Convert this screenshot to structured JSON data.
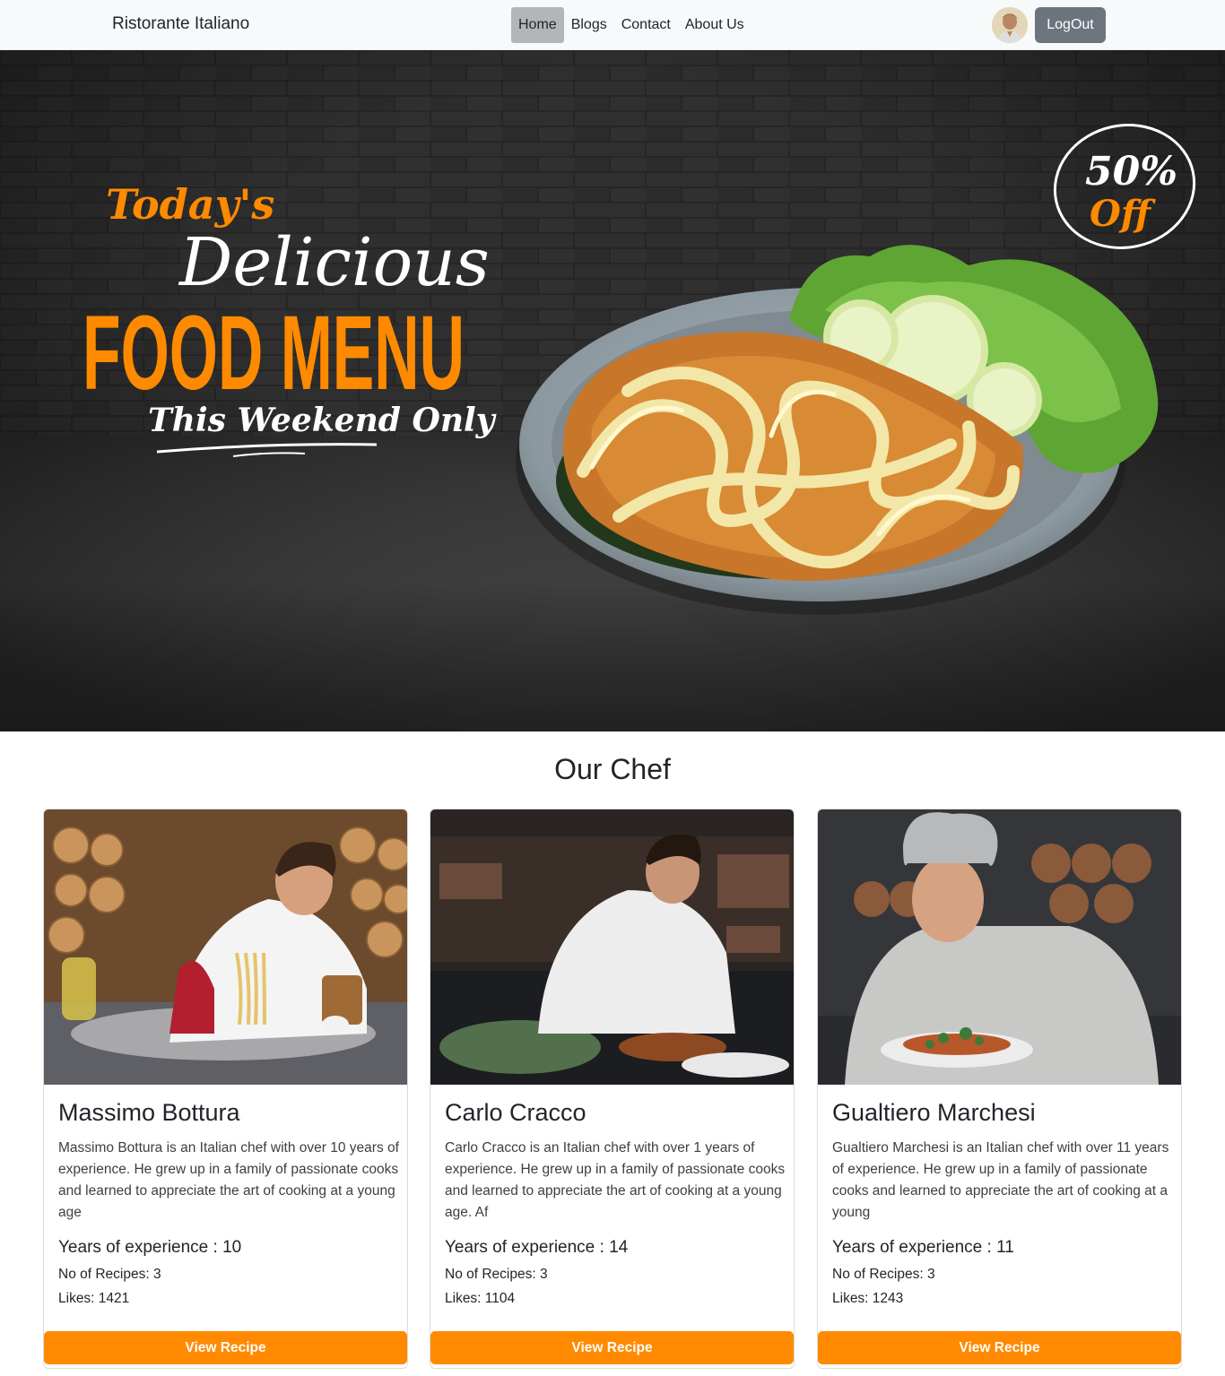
{
  "nav": {
    "brand": "Ristorante Italiano",
    "links": [
      {
        "label": "Home"
      },
      {
        "label": "Blogs"
      },
      {
        "label": "Contact"
      },
      {
        "label": "About Us"
      }
    ],
    "logout_label": "LogOut"
  },
  "hero": {
    "line1": "Today's",
    "line2": "Delicious",
    "line3": "FOOD MENU",
    "line4": "This Weekend Only",
    "badge_top": "50%",
    "badge_bottom": "Off"
  },
  "section": {
    "title": "Our Chef"
  },
  "chefs": [
    {
      "name": "Massimo Bottura",
      "bio": "Massimo Bottura is an Italian chef with over 10 years of experience. He grew up in a family of passionate cooks and learned to appreciate the art of cooking at a young age",
      "experience": "Years of experience : 10",
      "recipes": "No of Recipes: 3",
      "likes": "Likes: 1421",
      "button": "View Recipe"
    },
    {
      "name": "Carlo Cracco",
      "bio": "Carlo Cracco is an Italian chef with over 1 years of experience. He grew up in a family of passionate cooks and learned to appreciate the art of cooking at a young age. Af",
      "experience": "Years of experience : 14",
      "recipes": "No of Recipes: 3",
      "likes": "Likes: 1104",
      "button": "View Recipe"
    },
    {
      "name": "Gualtiero Marchesi",
      "bio": "Gualtiero Marchesi is an Italian chef with over 11 years of experience. He grew up in a family of passionate cooks and learned to appreciate the art of cooking at a young",
      "experience": "Years of experience : 11",
      "recipes": "No of Recipes: 3",
      "likes": "Likes: 1243",
      "button": "View Recipe"
    }
  ],
  "colors": {
    "accent": "#ff8a00",
    "navbar_bg": "#f8f9fa",
    "logout_bg": "#6c757d"
  }
}
